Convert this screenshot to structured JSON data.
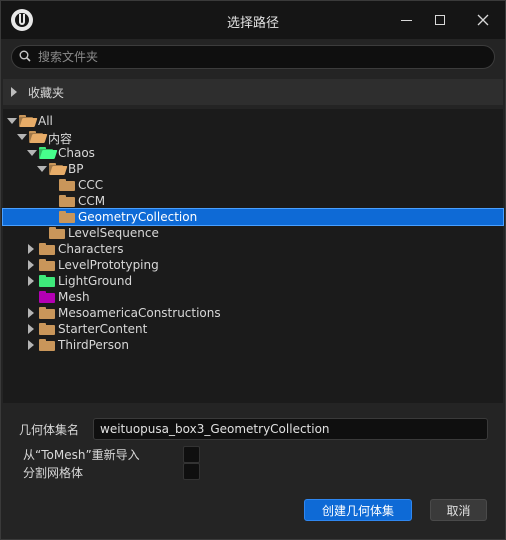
{
  "window": {
    "title": "选择路径"
  },
  "search": {
    "placeholder": "搜索文件夹",
    "value": ""
  },
  "favorites": {
    "label": "收藏夹"
  },
  "tree": {
    "items": [
      {
        "label": "All",
        "expanded": true,
        "folder_color": "#c9965a"
      },
      {
        "label": "内容",
        "expanded": true,
        "folder_color": "#c9965a"
      },
      {
        "label": "Chaos",
        "expanded": true,
        "folder_color": "#3ee87a"
      },
      {
        "label": "BP",
        "expanded": true,
        "folder_color": "#c9965a"
      },
      {
        "label": "CCC",
        "folder_color": "#c9965a"
      },
      {
        "label": "CCM",
        "folder_color": "#c9965a"
      },
      {
        "label": "GeometryCollection",
        "selected": true,
        "folder_color": "#c9965a"
      },
      {
        "label": "LevelSequence",
        "folder_color": "#c9965a"
      },
      {
        "label": "Characters",
        "expanded": false,
        "folder_color": "#c9965a"
      },
      {
        "label": "LevelPrototyping",
        "expanded": false,
        "folder_color": "#c9965a"
      },
      {
        "label": "LightGround",
        "expanded": false,
        "folder_color": "#3ee87a"
      },
      {
        "label": "Mesh",
        "folder_color": "#b400b4"
      },
      {
        "label": "MesoamericaConstructions",
        "expanded": false,
        "folder_color": "#c9965a"
      },
      {
        "label": "StarterContent",
        "expanded": false,
        "folder_color": "#c9965a"
      },
      {
        "label": "ThirdPerson",
        "expanded": false,
        "folder_color": "#c9965a"
      }
    ]
  },
  "form": {
    "name_label": "几何体集名",
    "name_value": "weituopusa_box3_GeometryCollection",
    "reimport_label": "从“ToMesh”重新导入",
    "reimport_checked": false,
    "split_label": "分割网格体",
    "split_checked": false
  },
  "buttons": {
    "create": "创建几何体集",
    "cancel": "取消"
  },
  "colors": {
    "accent": "#0e6ad6",
    "background": "#242424",
    "tree_background": "#1b1b1b"
  }
}
